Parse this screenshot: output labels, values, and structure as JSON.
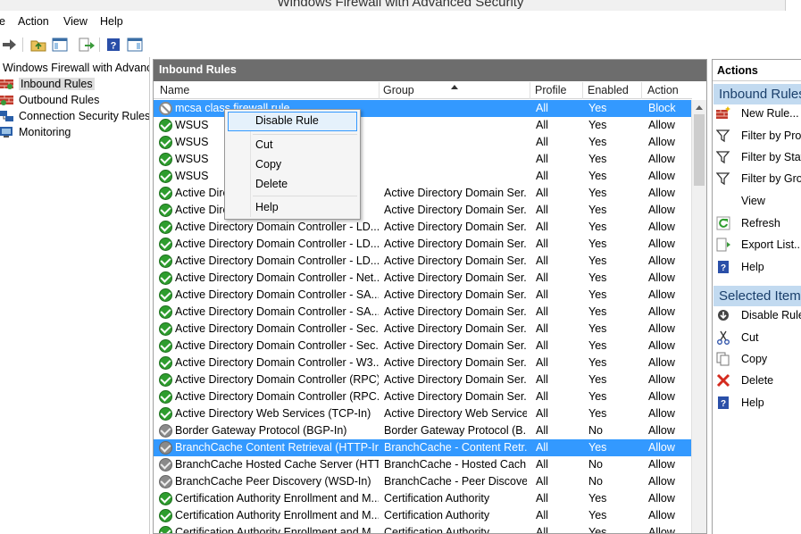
{
  "window": {
    "title": "Windows Firewall with Advanced Security"
  },
  "menu": {
    "file_partial": "e",
    "action": "Action",
    "view": "View",
    "help": "Help"
  },
  "tree": {
    "root": "Windows Firewall with Advance",
    "items": [
      {
        "label": "Inbound Rules",
        "selected": true
      },
      {
        "label": "Outbound Rules"
      },
      {
        "label": "Connection Security Rules"
      },
      {
        "label": "Monitoring"
      }
    ]
  },
  "center": {
    "header": "Inbound Rules",
    "columns": {
      "name": "Name",
      "group": "Group",
      "profile": "Profile",
      "enabled": "Enabled",
      "action": "Action"
    }
  },
  "rows": [
    {
      "name": "mcsa class firewall rule",
      "group": "",
      "profile": "All",
      "enabled": "Yes",
      "action": "Block",
      "icon": "block",
      "highlight": true
    },
    {
      "name": "WSUS",
      "group": "",
      "profile": "All",
      "enabled": "Yes",
      "action": "Allow",
      "icon": "allow"
    },
    {
      "name": "WSUS",
      "group": "",
      "profile": "All",
      "enabled": "Yes",
      "action": "Allow",
      "icon": "allow"
    },
    {
      "name": "WSUS",
      "group": "",
      "profile": "All",
      "enabled": "Yes",
      "action": "Allow",
      "icon": "allow"
    },
    {
      "name": "WSUS",
      "group": "",
      "profile": "All",
      "enabled": "Yes",
      "action": "Allow",
      "icon": "allow"
    },
    {
      "name": "Active Dire",
      "group": "Active Directory Domain Ser...",
      "profile": "All",
      "enabled": "Yes",
      "action": "Allow",
      "icon": "allow"
    },
    {
      "name": "Active Dire",
      "group": "Active Directory Domain Ser...",
      "profile": "All",
      "enabled": "Yes",
      "action": "Allow",
      "icon": "allow"
    },
    {
      "name": "Active Directory Domain Controller - LD...",
      "group": "Active Directory Domain Ser...",
      "profile": "All",
      "enabled": "Yes",
      "action": "Allow",
      "icon": "allow"
    },
    {
      "name": "Active Directory Domain Controller - LD...",
      "group": "Active Directory Domain Ser...",
      "profile": "All",
      "enabled": "Yes",
      "action": "Allow",
      "icon": "allow"
    },
    {
      "name": "Active Directory Domain Controller - LD...",
      "group": "Active Directory Domain Ser...",
      "profile": "All",
      "enabled": "Yes",
      "action": "Allow",
      "icon": "allow"
    },
    {
      "name": "Active Directory Domain Controller - Net...",
      "group": "Active Directory Domain Ser...",
      "profile": "All",
      "enabled": "Yes",
      "action": "Allow",
      "icon": "allow"
    },
    {
      "name": "Active Directory Domain Controller - SA...",
      "group": "Active Directory Domain Ser...",
      "profile": "All",
      "enabled": "Yes",
      "action": "Allow",
      "icon": "allow"
    },
    {
      "name": "Active Directory Domain Controller - SA...",
      "group": "Active Directory Domain Ser...",
      "profile": "All",
      "enabled": "Yes",
      "action": "Allow",
      "icon": "allow"
    },
    {
      "name": "Active Directory Domain Controller - Sec...",
      "group": "Active Directory Domain Ser...",
      "profile": "All",
      "enabled": "Yes",
      "action": "Allow",
      "icon": "allow"
    },
    {
      "name": "Active Directory Domain Controller - Sec...",
      "group": "Active Directory Domain Ser...",
      "profile": "All",
      "enabled": "Yes",
      "action": "Allow",
      "icon": "allow"
    },
    {
      "name": "Active Directory Domain Controller - W3...",
      "group": "Active Directory Domain Ser...",
      "profile": "All",
      "enabled": "Yes",
      "action": "Allow",
      "icon": "allow"
    },
    {
      "name": "Active Directory Domain Controller (RPC)",
      "group": "Active Directory Domain Ser...",
      "profile": "All",
      "enabled": "Yes",
      "action": "Allow",
      "icon": "allow"
    },
    {
      "name": "Active Directory Domain Controller (RPC...",
      "group": "Active Directory Domain Ser...",
      "profile": "All",
      "enabled": "Yes",
      "action": "Allow",
      "icon": "allow"
    },
    {
      "name": "Active Directory Web Services (TCP-In)",
      "group": "Active Directory Web Services",
      "profile": "All",
      "enabled": "Yes",
      "action": "Allow",
      "icon": "allow"
    },
    {
      "name": "Border Gateway Protocol (BGP-In)",
      "group": "Border Gateway Protocol (B...",
      "profile": "All",
      "enabled": "No",
      "action": "Allow",
      "icon": "disabled"
    },
    {
      "name": "BranchCache Content Retrieval (HTTP-In)",
      "group": "BranchCache - Content Retr...",
      "profile": "All",
      "enabled": "Yes",
      "action": "Allow",
      "icon": "disabled",
      "highlight": true
    },
    {
      "name": "BranchCache Hosted Cache Server (HTT...",
      "group": "BranchCache - Hosted Cach...",
      "profile": "All",
      "enabled": "No",
      "action": "Allow",
      "icon": "disabled"
    },
    {
      "name": "BranchCache Peer Discovery (WSD-In)",
      "group": "BranchCache - Peer Discove...",
      "profile": "All",
      "enabled": "No",
      "action": "Allow",
      "icon": "disabled"
    },
    {
      "name": "Certification Authority Enrollment and M...",
      "group": "Certification Authority",
      "profile": "All",
      "enabled": "Yes",
      "action": "Allow",
      "icon": "allow"
    },
    {
      "name": "Certification Authority Enrollment and M...",
      "group": "Certification Authority",
      "profile": "All",
      "enabled": "Yes",
      "action": "Allow",
      "icon": "allow"
    },
    {
      "name": "Certification Authority Enrollment and M...",
      "group": "Certification Authority",
      "profile": "All",
      "enabled": "Yes",
      "action": "Allow",
      "icon": "allow"
    }
  ],
  "context_menu": {
    "disable_rule": "Disable Rule",
    "cut": "Cut",
    "copy": "Copy",
    "delete": "Delete",
    "help": "Help"
  },
  "actions": {
    "title": "Actions",
    "section1": "Inbound Rules",
    "section1_items": [
      "New Rule...",
      "Filter by Profile",
      "Filter by State",
      "Filter by Group",
      "View",
      "Refresh",
      "Export List...",
      "Help"
    ],
    "section2": "Selected Items",
    "section2_items": [
      "Disable Rule",
      "Cut",
      "Copy",
      "Delete",
      "Help"
    ]
  },
  "colors": {
    "highlight": "#3399ff",
    "header_bg": "#6d6d6d",
    "section_bg": "#c2daf0",
    "allow_green": "#2e9d2e"
  }
}
